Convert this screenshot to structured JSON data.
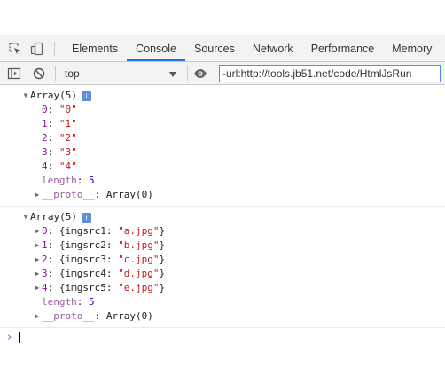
{
  "tabs": [
    "Elements",
    "Console",
    "Sources",
    "Network",
    "Performance",
    "Memory"
  ],
  "active_tab": "Console",
  "context": "top",
  "filter_value": "-url:http://tools.jb51.net/code/HtmlJsRun",
  "messages": [
    {
      "header": "Array(5)",
      "items": [
        {
          "key": "0",
          "value": "\"0\""
        },
        {
          "key": "1",
          "value": "\"1\""
        },
        {
          "key": "2",
          "value": "\"2\""
        },
        {
          "key": "3",
          "value": "\"3\""
        },
        {
          "key": "4",
          "value": "\"4\""
        }
      ],
      "length_label": "length",
      "length_value": "5",
      "proto_label": "__proto__",
      "proto_value": ": Array(0)"
    },
    {
      "header": "Array(5)",
      "objects": [
        {
          "key": "0",
          "prop": "imgsrc1",
          "val": "\"a.jpg\""
        },
        {
          "key": "1",
          "prop": "imgsrc2",
          "val": "\"b.jpg\""
        },
        {
          "key": "2",
          "prop": "imgsrc3",
          "val": "\"c.jpg\""
        },
        {
          "key": "3",
          "prop": "imgsrc4",
          "val": "\"d.jpg\""
        },
        {
          "key": "4",
          "prop": "imgsrc5",
          "val": "\"e.jpg\""
        }
      ],
      "length_label": "length",
      "length_value": "5",
      "proto_label": "__proto__",
      "proto_value": ": Array(0)"
    }
  ],
  "icons": {
    "inspect": "inspect-element-icon",
    "device": "device-toolbar-icon",
    "sidebar": "console-sidebar-icon",
    "clear": "clear-console-icon",
    "eye": "live-expression-icon",
    "info": "info-icon"
  }
}
